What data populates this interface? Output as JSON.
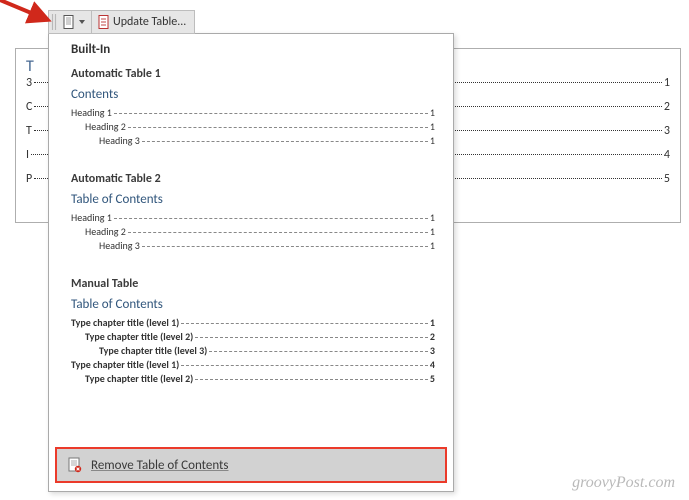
{
  "toolbar": {
    "update_label": "Update Table..."
  },
  "bg_toc": {
    "title": "T",
    "rows": [
      {
        "letter": "3",
        "page": "1"
      },
      {
        "letter": "C",
        "page": "2"
      },
      {
        "letter": "T",
        "page": "3"
      },
      {
        "letter": "I",
        "page": "4"
      },
      {
        "letter": "P",
        "page": "5"
      }
    ]
  },
  "panel": {
    "builtin_label": "Built-In",
    "presets": [
      {
        "name": "Automatic Table 1",
        "title": "Contents",
        "lines": [
          {
            "label": "Heading 1",
            "page": "1",
            "indent": 0,
            "bold": false
          },
          {
            "label": "Heading 2",
            "page": "1",
            "indent": 1,
            "bold": false
          },
          {
            "label": "Heading 3",
            "page": "1",
            "indent": 2,
            "bold": false
          }
        ]
      },
      {
        "name": "Automatic Table 2",
        "title": "Table of Contents",
        "lines": [
          {
            "label": "Heading 1",
            "page": "1",
            "indent": 0,
            "bold": false
          },
          {
            "label": "Heading 2",
            "page": "1",
            "indent": 1,
            "bold": false
          },
          {
            "label": "Heading 3",
            "page": "1",
            "indent": 2,
            "bold": false
          }
        ]
      },
      {
        "name": "Manual Table",
        "title": "Table of Contents",
        "lines": [
          {
            "label": "Type chapter title (level 1)",
            "page": "1",
            "indent": 0,
            "bold": true
          },
          {
            "label": "Type chapter title (level 2)",
            "page": "2",
            "indent": 1,
            "bold": true
          },
          {
            "label": "Type chapter title (level 3)",
            "page": "3",
            "indent": 2,
            "bold": true
          },
          {
            "label": "Type chapter title (level 1)",
            "page": "4",
            "indent": 0,
            "bold": true
          },
          {
            "label": "Type chapter title (level 2)",
            "page": "5",
            "indent": 1,
            "bold": true
          }
        ]
      }
    ],
    "remove_label": "Remove Table of Contents"
  },
  "watermark": "groovyPost.com"
}
